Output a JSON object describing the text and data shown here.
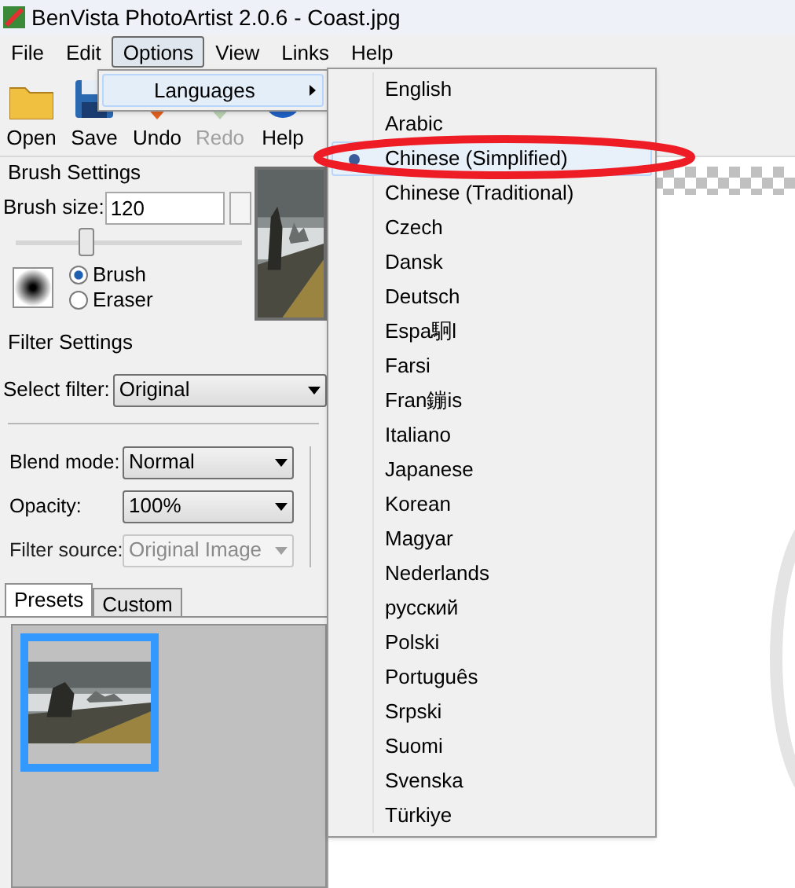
{
  "window": {
    "title": "BenVista PhotoArtist 2.0.6 - Coast.jpg"
  },
  "menu_bar": [
    {
      "label": "File",
      "selected": false
    },
    {
      "label": "Edit",
      "selected": false
    },
    {
      "label": "Options",
      "selected": true
    },
    {
      "label": "View",
      "selected": false
    },
    {
      "label": "Links",
      "selected": false
    },
    {
      "label": "Help",
      "selected": false
    }
  ],
  "options_menu": [
    {
      "label": "Languages",
      "expanded": true
    }
  ],
  "languages_menu": [
    {
      "label": "English",
      "selected": false
    },
    {
      "label": "Arabic",
      "selected": false
    },
    {
      "label": "Chinese (Simplified)",
      "selected": true
    },
    {
      "label": "Chinese (Traditional)",
      "selected": false
    },
    {
      "label": "Czech",
      "selected": false
    },
    {
      "label": "Dansk",
      "selected": false
    },
    {
      "label": "Deutsch",
      "selected": false
    },
    {
      "label": "Espa駉l",
      "selected": false
    },
    {
      "label": "Farsi",
      "selected": false
    },
    {
      "label": "Fran鏰is",
      "selected": false
    },
    {
      "label": "Italiano",
      "selected": false
    },
    {
      "label": "Japanese",
      "selected": false
    },
    {
      "label": "Korean",
      "selected": false
    },
    {
      "label": "Magyar",
      "selected": false
    },
    {
      "label": "Nederlands",
      "selected": false
    },
    {
      "label": "русский",
      "selected": false
    },
    {
      "label": "Polski",
      "selected": false
    },
    {
      "label": "Português",
      "selected": false
    },
    {
      "label": "Srpski",
      "selected": false
    },
    {
      "label": "Suomi",
      "selected": false
    },
    {
      "label": "Svenska",
      "selected": false
    },
    {
      "label": "Türkiye",
      "selected": false
    }
  ],
  "toolbar": [
    {
      "kind": "open",
      "label": "Open",
      "disabled": false
    },
    {
      "kind": "save",
      "label": "Save",
      "disabled": false
    },
    {
      "kind": "undo",
      "label": "Undo",
      "disabled": false
    },
    {
      "kind": "redo",
      "label": "Redo",
      "disabled": true
    },
    {
      "kind": "help",
      "label": "Help",
      "disabled": false
    }
  ],
  "brush_settings": {
    "title": "Brush Settings",
    "size_label": "Brush size:",
    "size_value": "120",
    "level": 0.31,
    "modes": [
      {
        "label": "Brush",
        "selected": true
      },
      {
        "label": "Eraser",
        "selected": false
      }
    ]
  },
  "filter_settings": {
    "title": "Filter Settings",
    "select_label": "Select filter:",
    "select_value": "Original",
    "fields": [
      {
        "label": "Blend mode:",
        "value": "Normal",
        "disabled": false
      },
      {
        "label": "Opacity:",
        "value": "100%",
        "disabled": false
      },
      {
        "label": "Filter source:",
        "value": "Original Image",
        "disabled": true
      }
    ]
  },
  "tabs": [
    {
      "label": "Presets",
      "selected": true
    },
    {
      "label": "Custom",
      "selected": false
    }
  ],
  "presets": [
    {
      "kind": "picture",
      "selected": true
    }
  ]
}
